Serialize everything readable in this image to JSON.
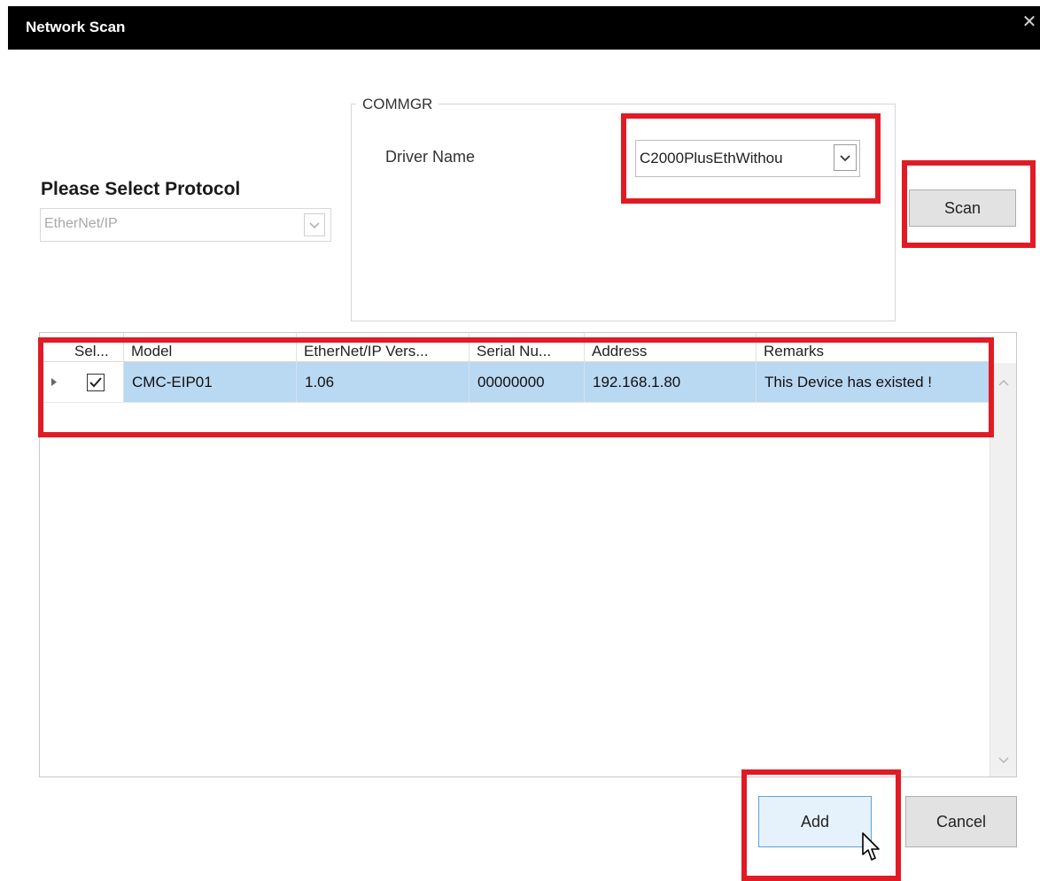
{
  "window": {
    "title": "Network Scan"
  },
  "protocol": {
    "label": "Please Select Protocol",
    "value": "EtherNet/IP"
  },
  "commgr": {
    "legend": "COMMGR",
    "driver_label": "Driver Name",
    "driver_value": "C2000PlusEthWithou"
  },
  "buttons": {
    "scan": "Scan",
    "add": "Add",
    "cancel": "Cancel"
  },
  "table": {
    "columns": [
      "Sel...",
      "Model",
      "EtherNet/IP Vers...",
      "Serial Nu...",
      "Address",
      "Remarks"
    ],
    "rows": [
      {
        "selected": true,
        "model": "CMC-EIP01",
        "version": "1.06",
        "serial": "00000000",
        "address": "192.168.1.80",
        "remarks": "This Device has existed !"
      }
    ]
  },
  "icons": {
    "close": "close-icon",
    "dropdown": "chevron-down-icon",
    "row_indicator": "triangle-right-icon",
    "scroll_up": "chevron-up-icon",
    "scroll_down": "chevron-down-icon",
    "cursor": "mouse-pointer-icon"
  },
  "colors": {
    "titlebar": "#000000",
    "selected_row": "#b9d8f1",
    "highlight": "#e11b25",
    "add_button_border": "#5fa3dd"
  }
}
